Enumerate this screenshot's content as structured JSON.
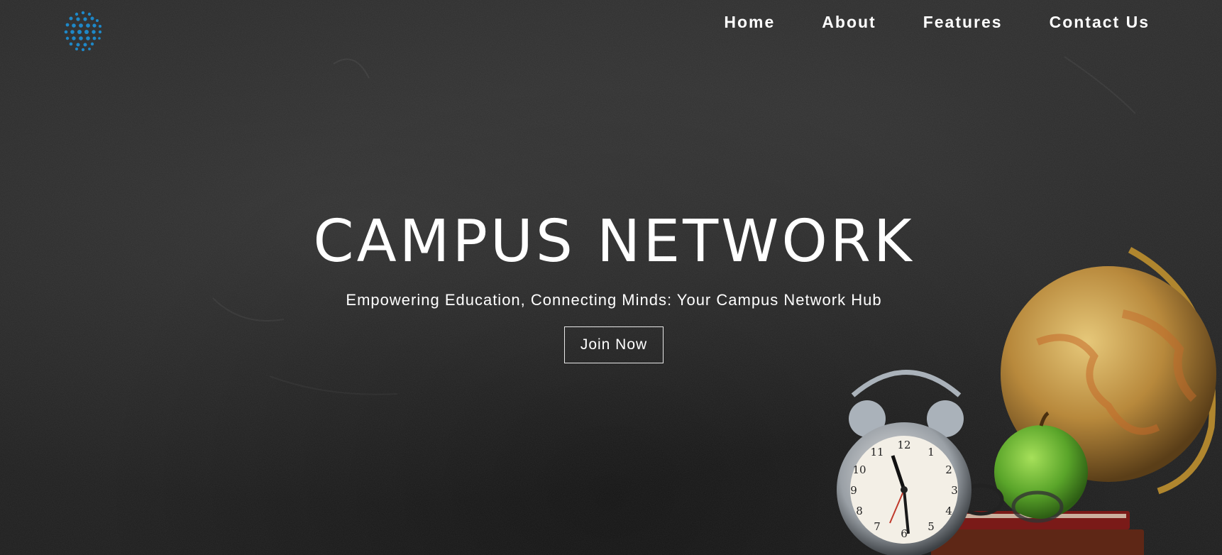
{
  "nav": {
    "items": [
      {
        "label": "Home"
      },
      {
        "label": "About"
      },
      {
        "label": "Features"
      },
      {
        "label": "Contact Us"
      }
    ]
  },
  "hero": {
    "title": "CAMPUS NETWORK",
    "subtitle": "Empowering Education, Connecting Minds: Your Campus Network Hub",
    "cta_label": "Join Now"
  },
  "colors": {
    "background": "#252525",
    "text": "#ffffff",
    "logo_accent": "#1e88c8"
  },
  "icons": {
    "logo": "globe-dots-icon"
  }
}
